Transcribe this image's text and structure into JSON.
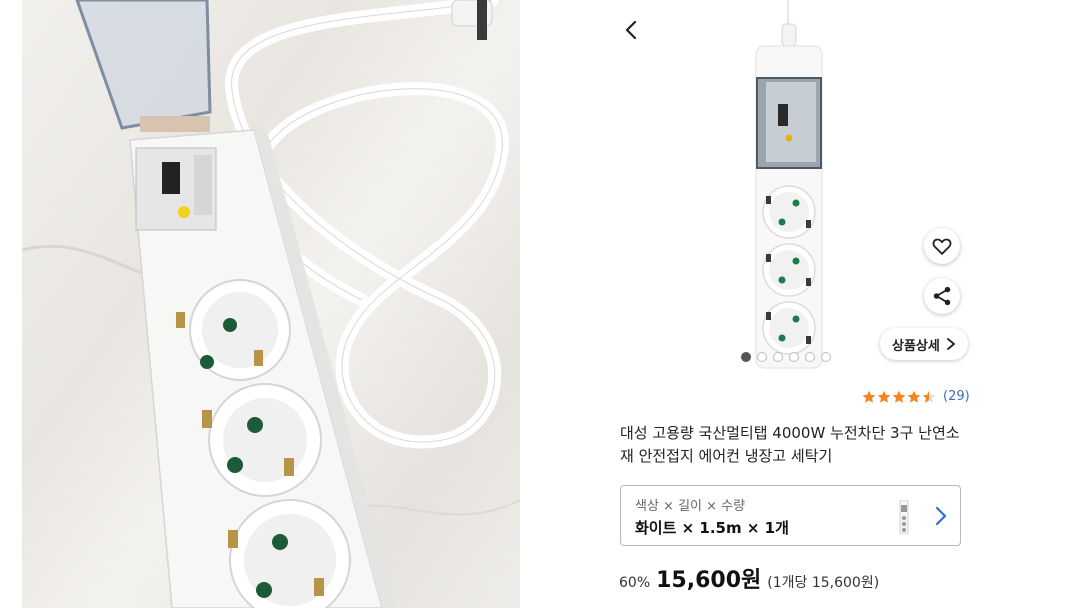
{
  "photo": {
    "alt_icon": "power-strip-photo"
  },
  "nav": {
    "back_icon": "chevron-left-icon"
  },
  "gallery": {
    "image_icon": "power-strip-product-image",
    "page_count": 6,
    "active_index": 0
  },
  "actions": {
    "wishlist_icon": "heart-icon",
    "share_icon": "share-icon",
    "detail_label": "상품상세",
    "detail_icon": "chevron-right-icon"
  },
  "rating": {
    "value": 4.5,
    "max": 5,
    "count": "(29)",
    "star_color": "#f5831f"
  },
  "product": {
    "title": "대성 고용량 국산멀티탭 4000W 누전차단 3구 난연소재 안전접지 에어컨 냉장고 세탁기"
  },
  "options": {
    "label": "색상 × 길이 × 수량",
    "value": "화이트 × 1.5m × 1개",
    "chevron_color": "#2f6fd6"
  },
  "price": {
    "discount": "60%",
    "amount": "15,600원",
    "unit_price": "(1개당 15,600원)"
  }
}
